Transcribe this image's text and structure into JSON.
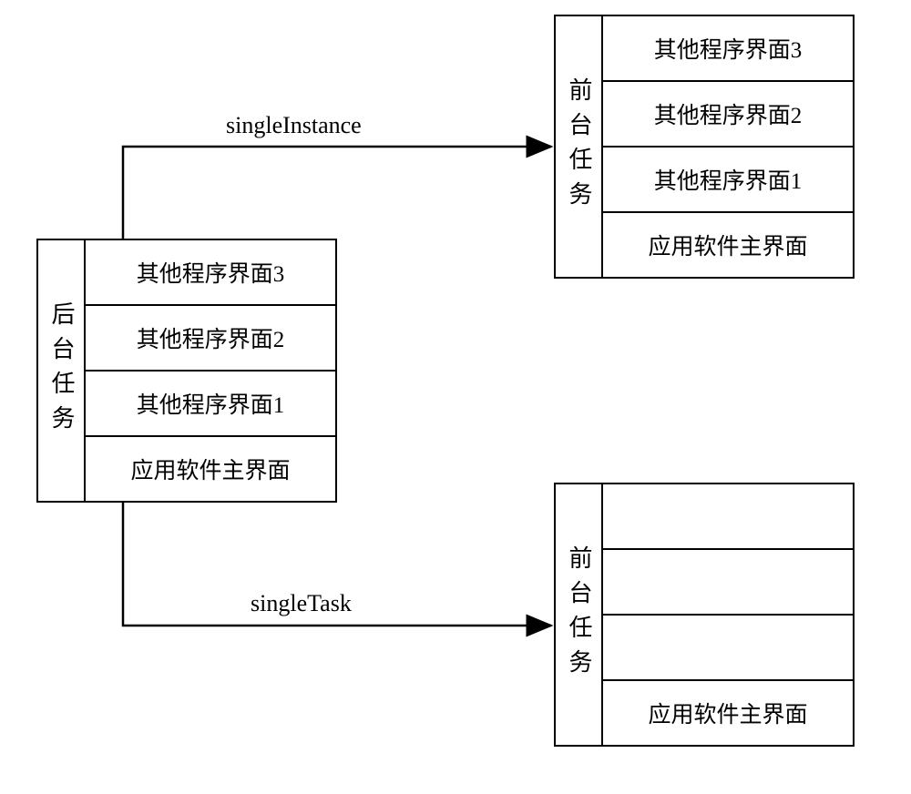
{
  "left_box": {
    "label": "后台任务",
    "rows": [
      "其他程序界面3",
      "其他程序界面2",
      "其他程序界面1",
      "应用软件主界面"
    ]
  },
  "top_right_box": {
    "label": "前台任务",
    "rows": [
      "其他程序界面3",
      "其他程序界面2",
      "其他程序界面1",
      "应用软件主界面"
    ]
  },
  "bottom_right_box": {
    "label": "前台任务",
    "rows": [
      "",
      "",
      "",
      "应用软件主界面"
    ]
  },
  "arrow_top_label": "singleInstance",
  "arrow_bottom_label": "singleTask"
}
